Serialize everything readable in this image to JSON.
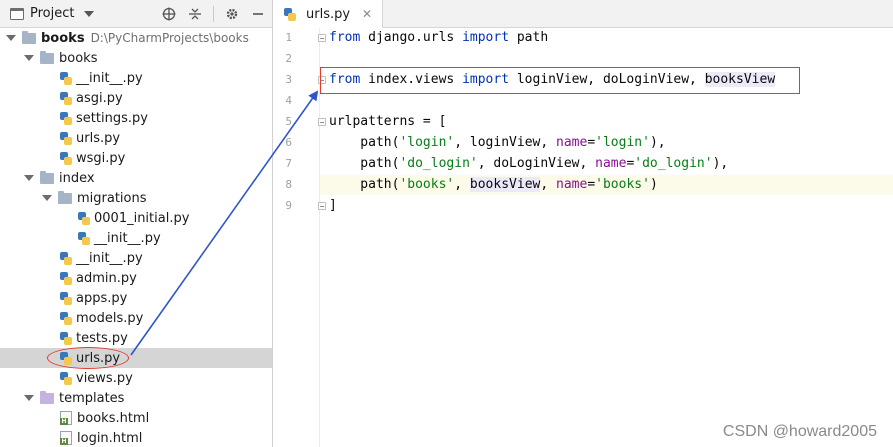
{
  "project_panel": {
    "title": "Project",
    "tools": [
      "globe-icon",
      "collapse-all-icon",
      "gear-icon",
      "hide-icon"
    ],
    "tree": [
      {
        "name": "books",
        "path": "D:\\PyCharmProjects\\books",
        "type": "root"
      },
      {
        "name": "books",
        "type": "folder"
      },
      {
        "name": "__init__.py",
        "type": "py"
      },
      {
        "name": "asgi.py",
        "type": "py"
      },
      {
        "name": "settings.py",
        "type": "py"
      },
      {
        "name": "urls.py",
        "type": "py"
      },
      {
        "name": "wsgi.py",
        "type": "py"
      },
      {
        "name": "index",
        "type": "folder"
      },
      {
        "name": "migrations",
        "type": "folder"
      },
      {
        "name": "0001_initial.py",
        "type": "py"
      },
      {
        "name": "__init__.py",
        "type": "py"
      },
      {
        "name": "__init__.py",
        "type": "py"
      },
      {
        "name": "admin.py",
        "type": "py"
      },
      {
        "name": "apps.py",
        "type": "py"
      },
      {
        "name": "models.py",
        "type": "py"
      },
      {
        "name": "tests.py",
        "type": "py"
      },
      {
        "name": "urls.py",
        "type": "py",
        "selected": true
      },
      {
        "name": "views.py",
        "type": "py"
      },
      {
        "name": "templates",
        "type": "folder"
      },
      {
        "name": "books.html",
        "type": "html"
      },
      {
        "name": "login.html",
        "type": "html"
      }
    ]
  },
  "editor": {
    "tab_label": "urls.py",
    "line_numbers": [
      "1",
      "2",
      "3",
      "4",
      "5",
      "6",
      "7",
      "8",
      "9"
    ],
    "lines": {
      "l1": {
        "kw1": "from",
        "mod": " django.urls ",
        "kw2": "import",
        "rest": " path"
      },
      "l3": {
        "kw1": "from",
        "mod": " index.views ",
        "kw2": "import",
        "rest": " loginView, doLoginView, ",
        "hl": "booksView"
      },
      "l5": {
        "text": "urlpatterns = ["
      },
      "l6": {
        "a": "    path(",
        "s1": "'login'",
        "b": ", loginView, ",
        "p": "name",
        "c": "=",
        "s2": "'login'",
        "d": "),"
      },
      "l7": {
        "a": "    path(",
        "s1": "'do_login'",
        "b": ", doLoginView, ",
        "p": "name",
        "c": "=",
        "s2": "'do_login'",
        "d": "),"
      },
      "l8": {
        "a": "    path(",
        "s1": "'books'",
        "b": ", ",
        "hl": "booksView",
        "b2": ", ",
        "p": "name",
        "c": "=",
        "s2": "'books'",
        "d": ")"
      },
      "l9": {
        "text": "]"
      }
    }
  },
  "watermark": "CSDN @howard2005",
  "colors": {
    "annotation_red": "#e23a2f",
    "arrow_blue": "#2f56c9",
    "keyword": "#0033b3",
    "string": "#067d17",
    "param": "#871094"
  }
}
